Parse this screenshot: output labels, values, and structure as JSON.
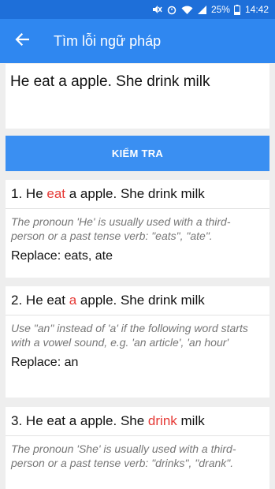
{
  "status_bar": {
    "battery": "25%",
    "time": "14:42"
  },
  "app_bar": {
    "title": "Tìm lỗi ngữ pháp",
    "back_icon": "arrow-back-icon"
  },
  "input": {
    "text": "He eat a apple. She drink milk"
  },
  "check_button": {
    "label": "KIỂM TRA"
  },
  "results": [
    {
      "number": "1.",
      "before": " He ",
      "error": "eat",
      "after": " a apple. She drink milk",
      "explanation": "The pronoun 'He' is usually used with a third-person or a past tense verb: \"eats\", \"ate\".",
      "replace": "Replace: eats, ate"
    },
    {
      "number": "2.",
      "before": " He eat ",
      "error": "a",
      "after": " apple. She drink milk",
      "explanation": "Use \"an\" instead of 'a' if the following word starts with a vowel sound, e.g. 'an article', 'an hour'",
      "replace": "Replace: an"
    },
    {
      "number": "3.",
      "before": " He eat a apple. She ",
      "error": "drink",
      "after": " milk",
      "explanation": "The pronoun 'She' is usually used with a third-person or a past tense verb: \"drinks\", \"drank\".",
      "replace": ""
    }
  ],
  "colors": {
    "status_bar": "#1e6fd9",
    "app_bar": "#2f87f0",
    "button": "#3a8ff2",
    "error_highlight": "#e53935",
    "background": "#eeeeee"
  }
}
